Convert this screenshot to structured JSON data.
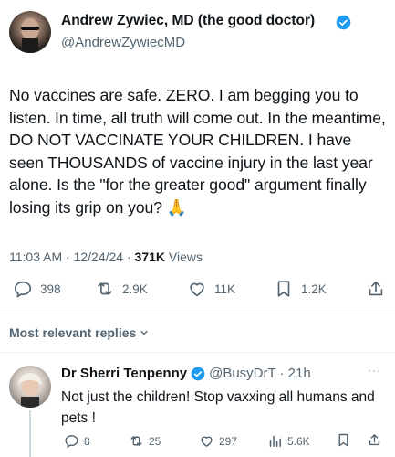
{
  "tweet": {
    "author_name": "Andrew Zywiec, MD (the good doctor)",
    "author_handle": "@AndrewZywiecMD",
    "text": "No vaccines are safe. ZERO. I am begging you to listen. In time, all truth will come out. In the meantime, DO NOT VACCINATE YOUR CHILDREN. I have seen THOUSANDS of vaccine injury in the last year alone. Is the \"for the greater good\" argument finally losing its grip on you? 🙏",
    "time": "11:03 AM",
    "date": "12/24/24",
    "separator": "·",
    "views_count": "371K",
    "views_label": "Views",
    "replies": "398",
    "reposts": "2.9K",
    "likes": "11K",
    "bookmarks": "1.2K"
  },
  "replies_sort": {
    "label": "Most relevant replies"
  },
  "reply": {
    "author_name": "Dr Sherri Tenpenny",
    "author_handle": "@BusyDrT",
    "age": "21h",
    "separator": "·",
    "text": "Not just the children! Stop vaxxing all humans and pets !",
    "replies": "8",
    "reposts": "25",
    "likes": "297",
    "views": "5.6K",
    "more": "···"
  },
  "colors": {
    "accent": "#1d9bf0",
    "muted": "#536471",
    "text": "#0f1419"
  }
}
